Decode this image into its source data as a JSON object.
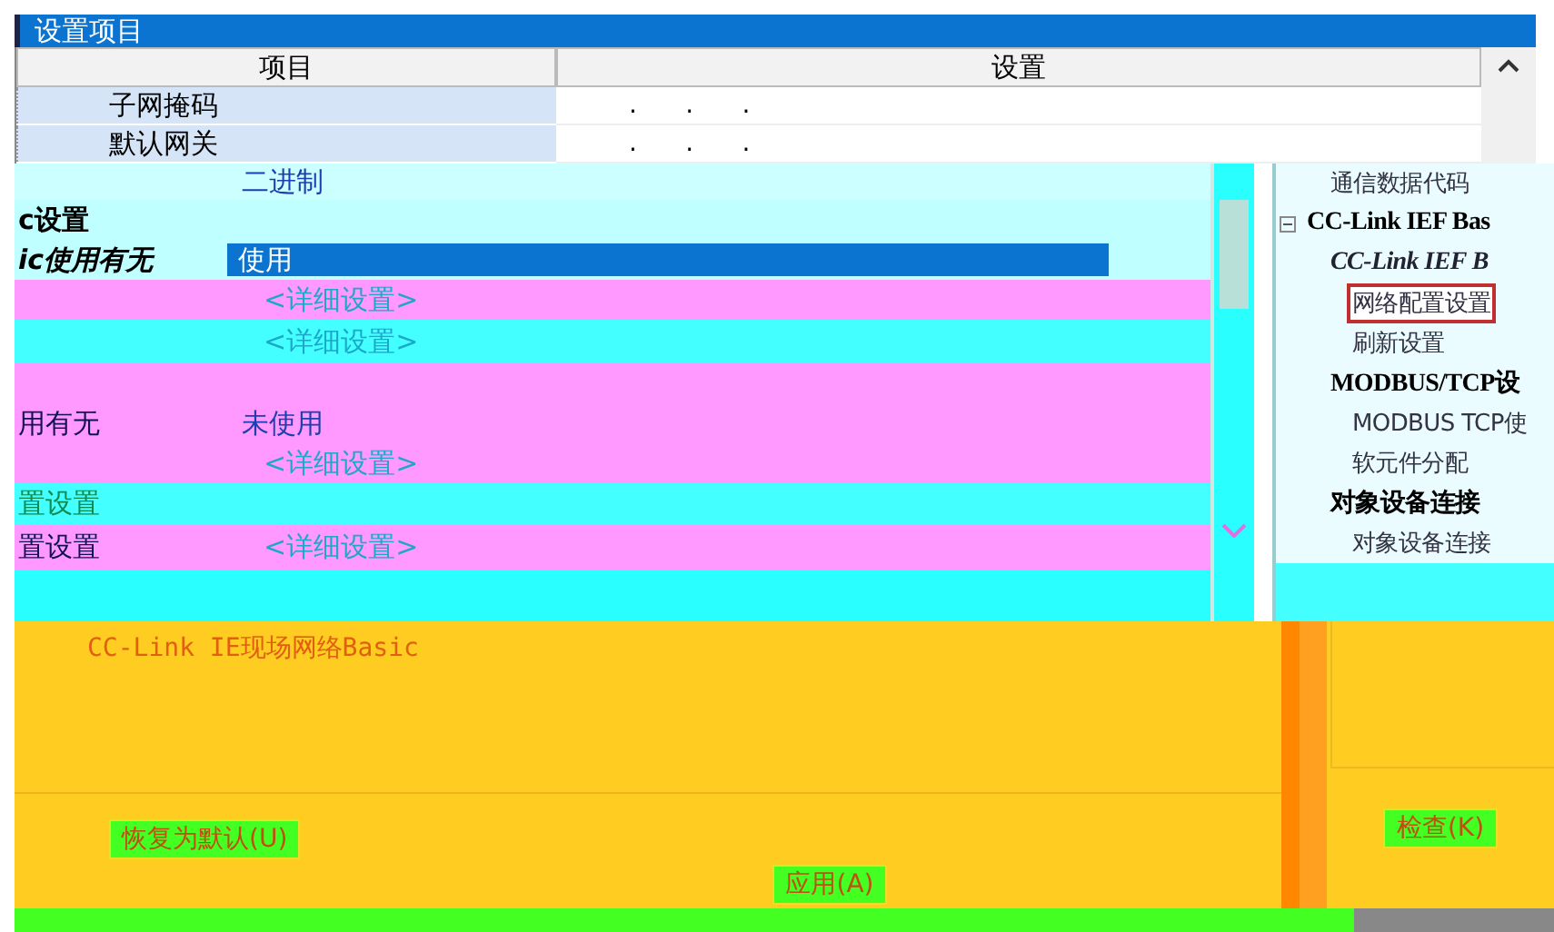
{
  "dialog": {
    "title": "设置项目"
  },
  "table": {
    "columns": [
      "项目",
      "设置"
    ],
    "rows": [
      {
        "item": "子网掩码",
        "value": ".      .      ."
      },
      {
        "item": "默认网关",
        "value": ".      .      ."
      }
    ]
  },
  "settings": [
    {
      "value": "二进制",
      "kind": "text"
    },
    {
      "label": "c设置",
      "kind": "heading"
    },
    {
      "label": "ic使用有无",
      "value": "使用",
      "kind": "combo"
    },
    {
      "value": "<详细设置>",
      "kind": "link"
    },
    {
      "value": "<详细设置>",
      "kind": "link"
    },
    {
      "kind": "blank"
    },
    {
      "label": "用有无",
      "value": "未使用",
      "kind": "text"
    },
    {
      "value": "<详细设置>",
      "kind": "link"
    },
    {
      "label": "置设置",
      "kind": "group"
    },
    {
      "label": "置设置",
      "value": "<详细设置>",
      "kind": "link"
    }
  ],
  "tree": [
    {
      "label": "通信数据代码",
      "kind": "plain",
      "selected": false
    },
    {
      "label": "CC-Link IEF Bas",
      "kind": "bold",
      "selected": false,
      "expanded": true,
      "children": [
        {
          "label": "CC-Link IEF B",
          "kind": "italic",
          "selected": false,
          "children": [
            {
              "label": "网络配置设置",
              "kind": "plain",
              "selected": true
            },
            {
              "label": "刷新设置",
              "kind": "plain",
              "selected": false
            }
          ]
        },
        {
          "label": "MODBUS/TCP设",
          "kind": "bold",
          "selected": false,
          "children": [
            {
              "label": "MODBUS TCP使",
              "kind": "plain",
              "selected": false
            },
            {
              "label": "软元件分配",
              "kind": "plain",
              "selected": false
            }
          ]
        },
        {
          "label": "对象设备连接",
          "kind": "bold",
          "selected": false,
          "children": [
            {
              "label": "对象设备连接",
              "kind": "plain",
              "selected": false
            }
          ]
        }
      ]
    }
  ],
  "description": "CC-Link IE现场网络Basic",
  "buttons": [
    {
      "label": "恢复为默认(U)"
    },
    {
      "label": "应用(A)"
    },
    {
      "label": "检查(K)"
    }
  ]
}
